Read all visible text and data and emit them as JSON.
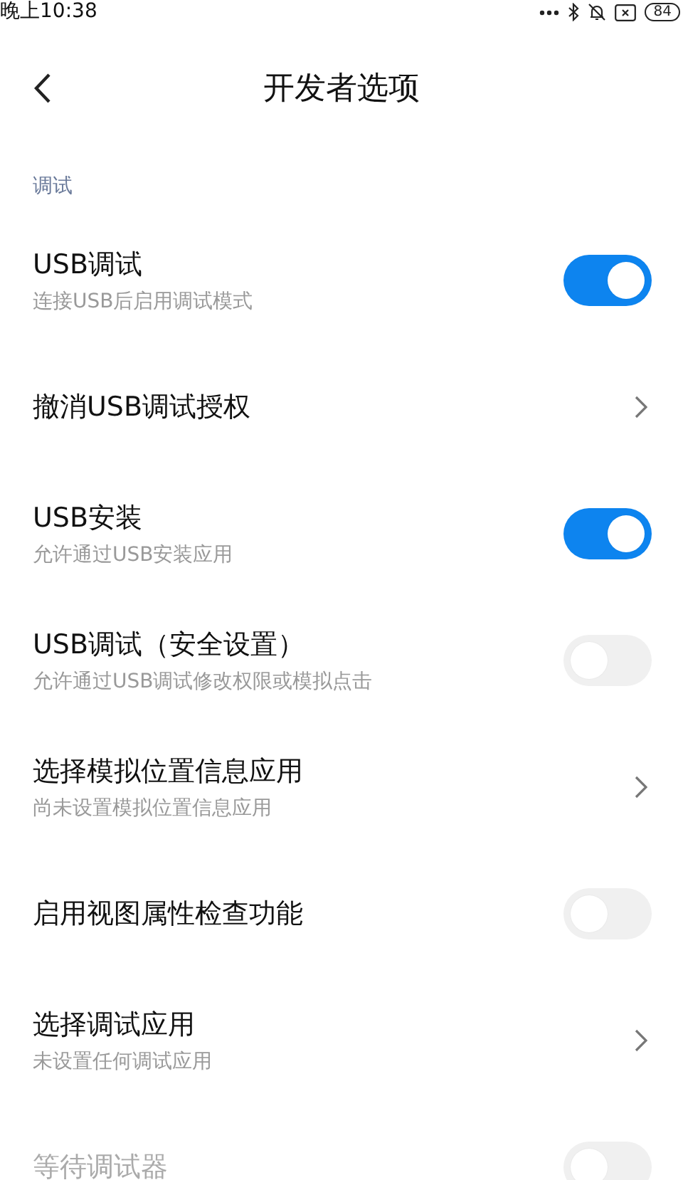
{
  "status_bar": {
    "time": "晚上10:38",
    "battery": "84"
  },
  "header": {
    "title": "开发者选项"
  },
  "section": {
    "title": "调试"
  },
  "items": [
    {
      "kind": "toggle",
      "title": "USB调试",
      "subtitle": "连接USB后启用调试模式",
      "on": true,
      "disabled": false
    },
    {
      "kind": "link",
      "title": "撤消USB调试授权",
      "disabled": false
    },
    {
      "kind": "toggle",
      "title": "USB安装",
      "subtitle": "允许通过USB安装应用",
      "on": true,
      "disabled": false
    },
    {
      "kind": "toggle",
      "title": "USB调试（安全设置）",
      "subtitle": "允许通过USB调试修改权限或模拟点击",
      "on": false,
      "disabled": false
    },
    {
      "kind": "link",
      "title": "选择模拟位置信息应用",
      "subtitle": "尚未设置模拟位置信息应用",
      "disabled": false
    },
    {
      "kind": "toggle",
      "title": "启用视图属性检查功能",
      "on": false,
      "disabled": false
    },
    {
      "kind": "link",
      "title": "选择调试应用",
      "subtitle": "未设置任何调试应用",
      "disabled": false
    },
    {
      "kind": "toggle",
      "title": "等待调试器",
      "on": false,
      "disabled": true
    }
  ]
}
